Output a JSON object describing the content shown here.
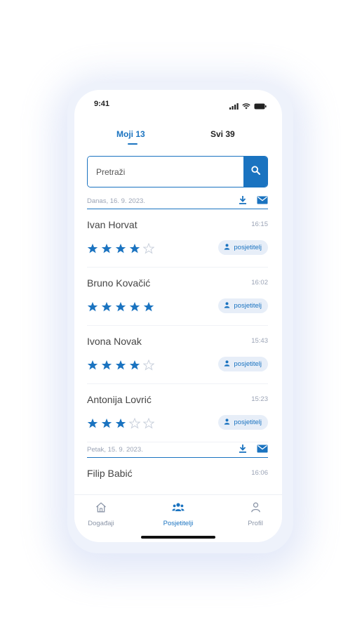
{
  "status_bar": {
    "time": "9:41"
  },
  "tabs": [
    {
      "label": "Moji",
      "count": "13",
      "active": true
    },
    {
      "label": "Svi",
      "count": "39",
      "active": false
    }
  ],
  "search": {
    "placeholder": "Pretraži"
  },
  "groups": [
    {
      "date": "Danas, 16. 9. 2023.",
      "visitors": [
        {
          "name": "Ivan Horvat",
          "time": "16:15",
          "rating": 4,
          "badge": "posjetitelj"
        },
        {
          "name": "Bruno Kovačić",
          "time": "16:02",
          "rating": 5,
          "badge": "posjetitelj"
        },
        {
          "name": "Ivona Novak",
          "time": "15:43",
          "rating": 4,
          "badge": "posjetitelj"
        },
        {
          "name": "Antonija Lovrić",
          "time": "15:23",
          "rating": 3,
          "badge": "posjetitelj"
        }
      ]
    },
    {
      "date": "Petak, 15. 9. 2023.",
      "visitors": [
        {
          "name": "Filip Babić",
          "time": "16:06",
          "rating": 0,
          "badge": ""
        }
      ]
    }
  ],
  "bottom_nav": [
    {
      "label": "Događaji",
      "icon": "home-icon",
      "active": false
    },
    {
      "label": "Posjetitelji",
      "icon": "people-icon",
      "active": true
    },
    {
      "label": "Profil",
      "icon": "person-icon",
      "active": false
    }
  ],
  "colors": {
    "accent": "#1a73c0",
    "badge_bg": "#e7eef8",
    "muted_text": "#9aa3b5",
    "star_empty": "#c9d0dc"
  },
  "max_rating": 5
}
